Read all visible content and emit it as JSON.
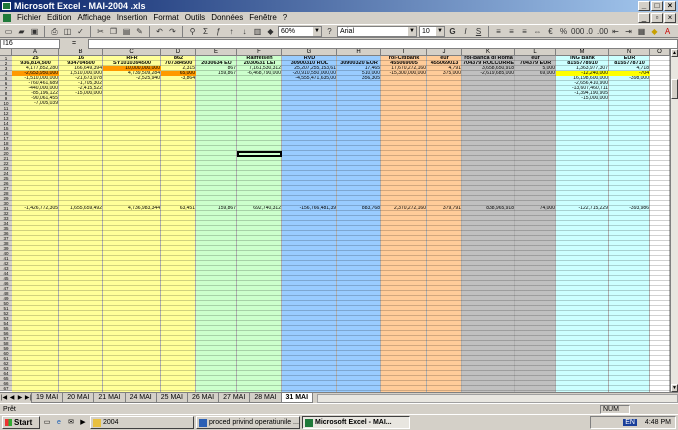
{
  "window": {
    "title": "Microsoft Excel - MAI-2004 .xls"
  },
  "menu": [
    "Fichier",
    "Edition",
    "Affichage",
    "Insertion",
    "Format",
    "Outils",
    "Données",
    "Fenêtre",
    "?"
  ],
  "toolbar": {
    "zoom": "60%",
    "font": "Arial",
    "size": "10"
  },
  "formula": {
    "namebox": "I16",
    "fx": "="
  },
  "columns": [
    "A",
    "B",
    "C",
    "D",
    "E",
    "F",
    "G",
    "H",
    "I",
    "J",
    "K",
    "L",
    "M",
    "N",
    "O",
    "P",
    "Q"
  ],
  "header_row1": [
    "25",
    "16",
    "RFR",
    "862",
    "",
    "Raiffeisen",
    "RVD",
    "",
    "rol-Citibank",
    "eur",
    "rol-Banca di Roma",
    "eur",
    "ING Bank",
    "EUR"
  ],
  "header_row2": [
    "936,814,500",
    "934704500",
    "SY1010394500",
    "707384500",
    "2030634 EU",
    "2030631 LEI",
    "30900310 ROL",
    "30900320 EUR",
    "455069005",
    "455069013",
    "704379 ROLCURRE",
    "704379 EUR",
    "8155778910",
    "8155778710"
  ],
  "data_rows": [
    [
      "4,177,852,280",
      "166,649,394",
      "10,000,000,000",
      "2,315",
      "867",
      "7,161,530,312",
      "25,207,255,153,61",
      "17,465",
      "17,670,272,160",
      "4,791",
      "3,658,650,918",
      "5,000",
      "1,363,977,307",
      "4,718"
    ],
    [
      "-2,653,950,000",
      "1,510,000,000",
      "4,739,509,284",
      "65,000",
      "159,867",
      "-6,468,790,000",
      "-20,910,550,000,00",
      "510,000",
      "-15,300,000,000",
      "375,000",
      "-2,619,685,000",
      "69,000",
      "-12,240,000",
      "-704"
    ],
    [
      "-1,510,000,000",
      "-21,673,078",
      "-2,525,940",
      "-3,864",
      "",
      "",
      "-4,555,471,635,00",
      "356,305",
      "",
      "",
      "",
      "",
      "16,198,600,000",
      "-398,000"
    ],
    [
      "-760,461,689",
      "-1,705,302",
      "",
      "",
      "",
      "",
      "",
      "",
      "",
      "",
      "",
      "",
      "-2,656,410,900",
      "",
      ""
    ],
    [
      "-440,000,000",
      "-2,415,522",
      "",
      "",
      "",
      "",
      "",
      "",
      "",
      "",
      "",
      "",
      "-13,607,460,711",
      "",
      ""
    ],
    [
      "-85,196,122",
      "-15,000,000",
      "",
      "",
      "",
      "",
      "",
      "",
      "",
      "",
      "",
      "",
      "-1,394,190,905",
      "",
      ""
    ],
    [
      "-90,061,455",
      "",
      "",
      "",
      "",
      "",
      "",
      "",
      "",
      "",
      "",
      "",
      "-15,000,000",
      "",
      ""
    ],
    [
      "-7,005,039",
      "",
      "",
      "",
      "",
      "",
      "",
      "",
      "",
      "",
      "",
      "",
      "",
      "",
      ""
    ]
  ],
  "totals_row": [
    "-1,426,772,305",
    "1,655,659,492",
    "4,736,983,344",
    "63,451",
    "159,867",
    "692,740,312",
    "-156,766,481,39",
    "883,768",
    "2,370,272,160",
    "379,791",
    "838,965,918",
    "74,000",
    "-122,715,229",
    "-393,986"
  ],
  "sheet_tabs": [
    "19 MAI",
    "20 MAI",
    "21 MAI",
    "24 MAI",
    "25 MAI",
    "26 MAI",
    "27 MAI",
    "28 MAI",
    "31 MAI"
  ],
  "active_tab": "31 MAI",
  "status": {
    "left": "Prêt",
    "num": "NUM"
  },
  "taskbar": {
    "start": "Start",
    "tasks": [
      "2004",
      "proced privind operatiunile ...",
      "Microsoft Excel - MAI..."
    ],
    "clock": "4:48 PM",
    "lang": "EN"
  }
}
